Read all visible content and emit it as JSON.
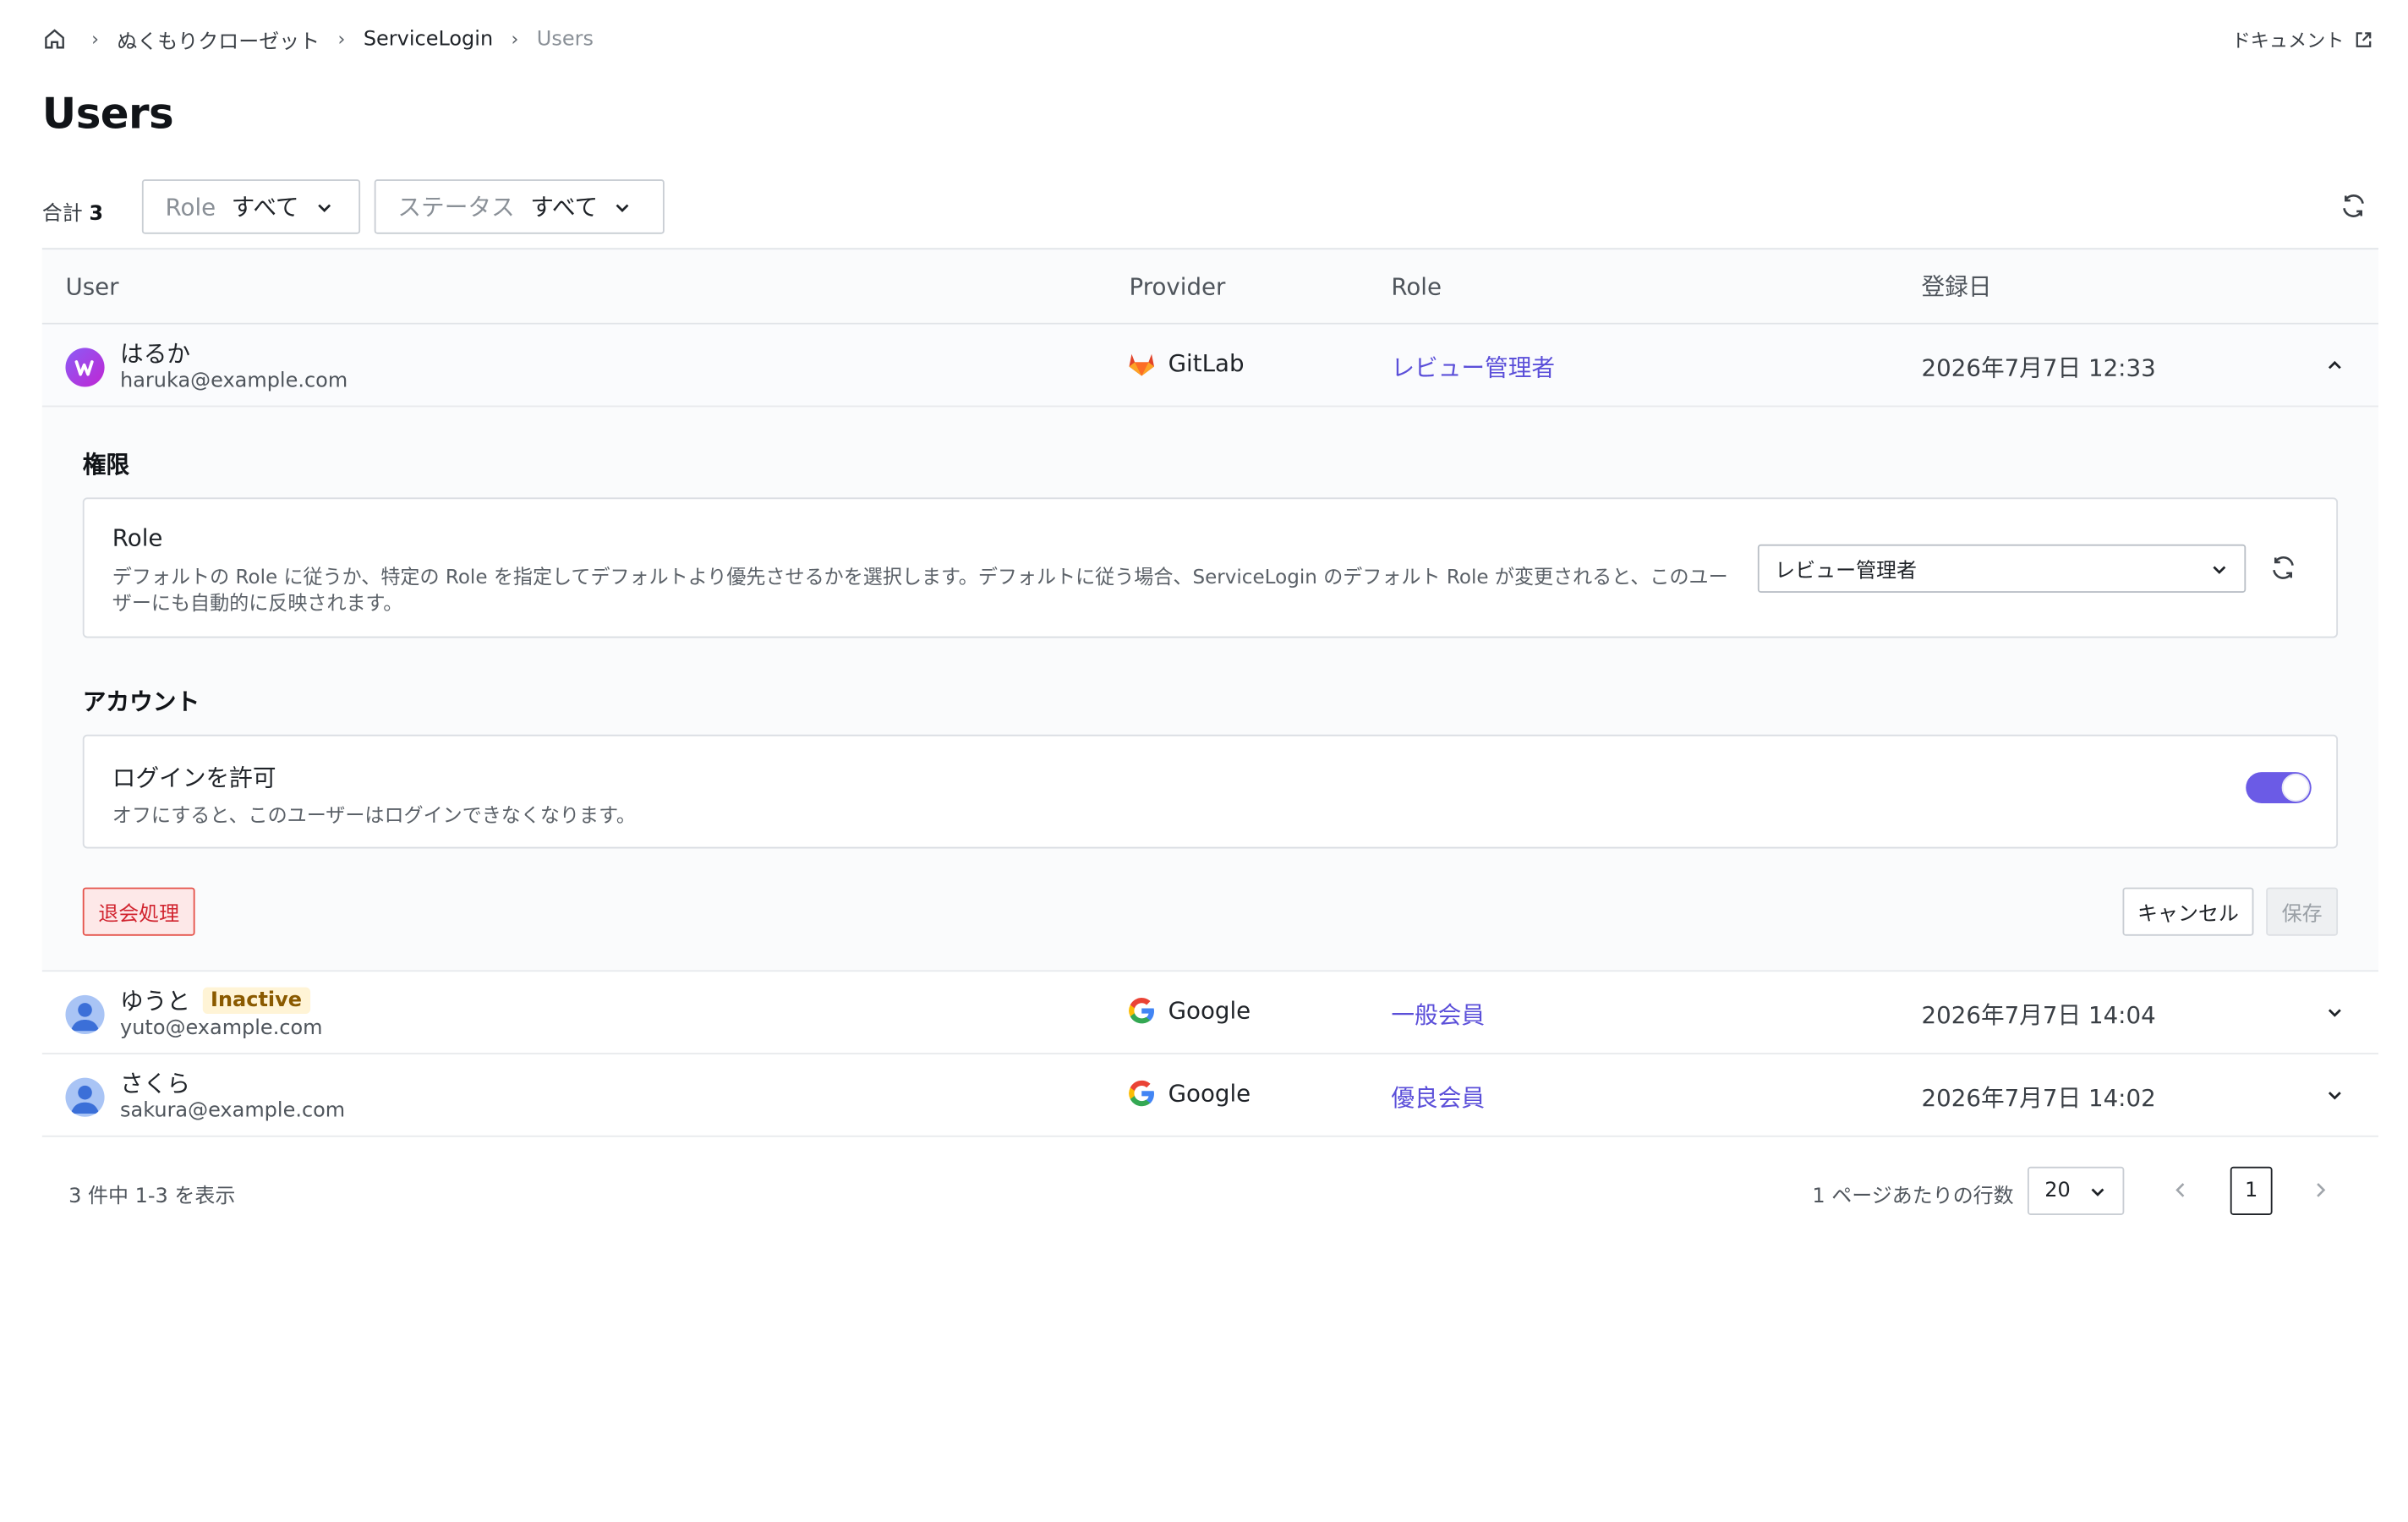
{
  "breadcrumb": {
    "items": [
      "ぬくもりクローゼット",
      "ServiceLogin",
      "Users"
    ]
  },
  "header": {
    "doc_link": "ドキュメント",
    "title": "Users"
  },
  "toolbar": {
    "total_label": "合計",
    "total_count": "3",
    "filters": [
      {
        "label": "Role",
        "value": "すべて"
      },
      {
        "label": "ステータス",
        "value": "すべて"
      }
    ]
  },
  "table": {
    "columns": [
      "User",
      "Provider",
      "Role",
      "登録日"
    ],
    "rows": [
      {
        "name": "はるか",
        "email": "haruka@example.com",
        "badge": "",
        "provider": "GitLab",
        "role": "レビュー管理者",
        "date": "2026年7月7日 12:33"
      },
      {
        "name": "ゆうと",
        "email": "yuto@example.com",
        "badge": "Inactive",
        "provider": "Google",
        "role": "一般会員",
        "date": "2026年7月7日 14:04"
      },
      {
        "name": "さくら",
        "email": "sakura@example.com",
        "badge": "",
        "provider": "Google",
        "role": "優良会員",
        "date": "2026年7月7日 14:02"
      }
    ]
  },
  "detail": {
    "permissions_title": "権限",
    "role_card": {
      "title": "Role",
      "description": "デフォルトの Role に従うか、特定の Role を指定してデフォルトより優先させるかを選択します。デフォルトに従う場合、ServiceLogin のデフォルト Role が変更されると、このユーザーにも自動的に反映されます。",
      "selected": "レビュー管理者"
    },
    "account_title": "アカウント",
    "login_card": {
      "title": "ログインを許可",
      "description": "オフにすると、このユーザーはログインできなくなります。",
      "enabled": true
    },
    "withdraw_button": "退会処理",
    "cancel_button": "キャンセル",
    "save_button": "保存"
  },
  "pagination": {
    "range_text": "3 件中 1-3 を表示",
    "rows_per_page_label": "1 ページあたりの行数",
    "rows_per_page": "20",
    "current_page": "1"
  },
  "colors": {
    "accent": "#6b5be6",
    "role_link": "#5b4fd9",
    "danger": "#d1242f",
    "inactive_badge_bg": "#fff4d6"
  }
}
